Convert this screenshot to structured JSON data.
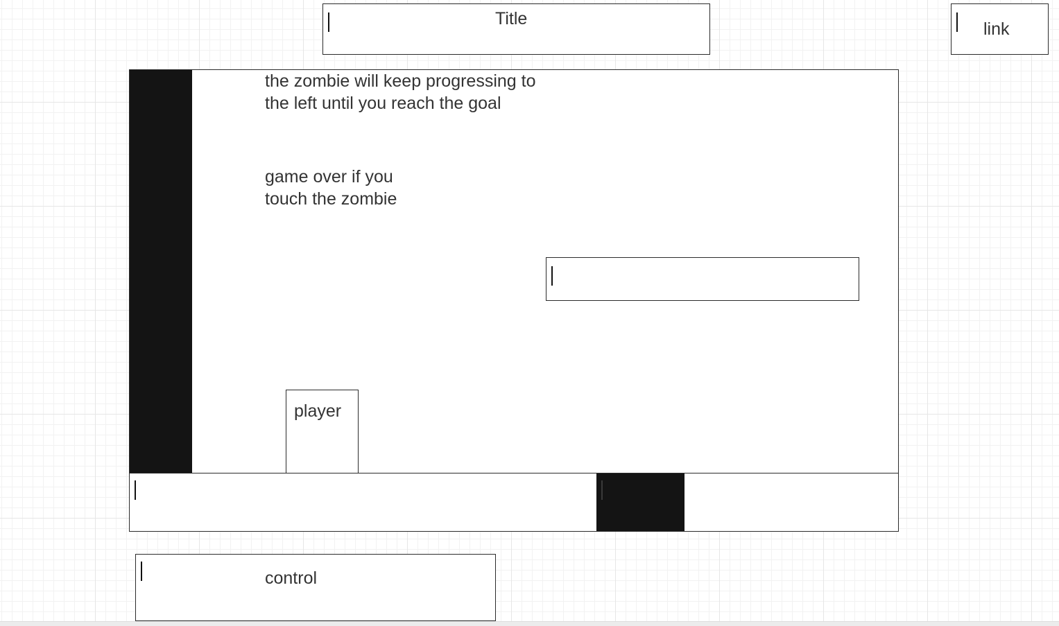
{
  "title_box": {
    "label": "Title"
  },
  "link_box": {
    "label": "link"
  },
  "game_area": {
    "instruction_1": [
      "the zombie will keep progressing to",
      "the left until you reach the goal"
    ],
    "instruction_2": [
      "game over if you",
      "touch the zombie"
    ],
    "player_label": "player"
  },
  "control_box": {
    "label": "control"
  },
  "colors": {
    "outline": "#2a2a2a",
    "fill_dark": "#141414",
    "text": "#333333",
    "grid": "#e6e6e6"
  }
}
